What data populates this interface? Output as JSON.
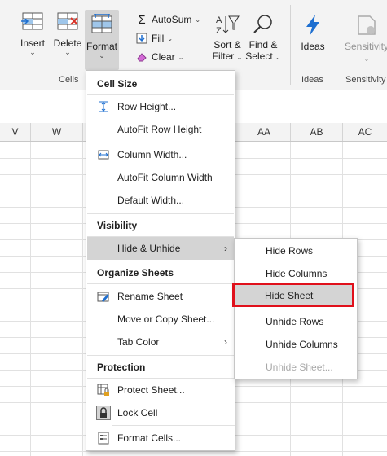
{
  "ribbon": {
    "insert_label": "Insert",
    "delete_label": "Delete",
    "format_label": "Format",
    "autosum_label": "AutoSum",
    "fill_label": "Fill",
    "clear_label": "Clear",
    "sort_label_1": "Sort &",
    "sort_label_2": "Filter",
    "find_label_1": "Find &",
    "find_label_2": "Select",
    "ideas_label": "Ideas",
    "sensitivity_label": "Sensitivity",
    "groups": {
      "cells": "Cells",
      "ideas": "Ideas",
      "sensitivity": "Sensitivity"
    }
  },
  "columns": [
    "V",
    "W",
    "AA",
    "AB",
    "AC"
  ],
  "format_menu": {
    "cell_size_header": "Cell Size",
    "row_height": "Row Height...",
    "autofit_row": "AutoFit Row Height",
    "column_width": "Column Width...",
    "autofit_column": "AutoFit Column Width",
    "default_width": "Default Width...",
    "visibility_header": "Visibility",
    "hide_unhide": "Hide & Unhide",
    "organize_header": "Organize Sheets",
    "rename_sheet": "Rename Sheet",
    "move_copy": "Move or Copy Sheet...",
    "tab_color": "Tab Color",
    "protection_header": "Protection",
    "protect_sheet": "Protect Sheet...",
    "lock_cell": "Lock Cell",
    "format_cells": "Format Cells..."
  },
  "hide_unhide_submenu": {
    "hide_rows": "Hide Rows",
    "hide_columns": "Hide Columns",
    "hide_sheet": "Hide Sheet",
    "unhide_rows": "Unhide Rows",
    "unhide_columns": "Unhide Columns",
    "unhide_sheet": "Unhide Sheet..."
  },
  "colors": {
    "highlight": "#d4d4d4",
    "callout": "#e0101b",
    "ideas_blue": "#1e6fd0"
  }
}
